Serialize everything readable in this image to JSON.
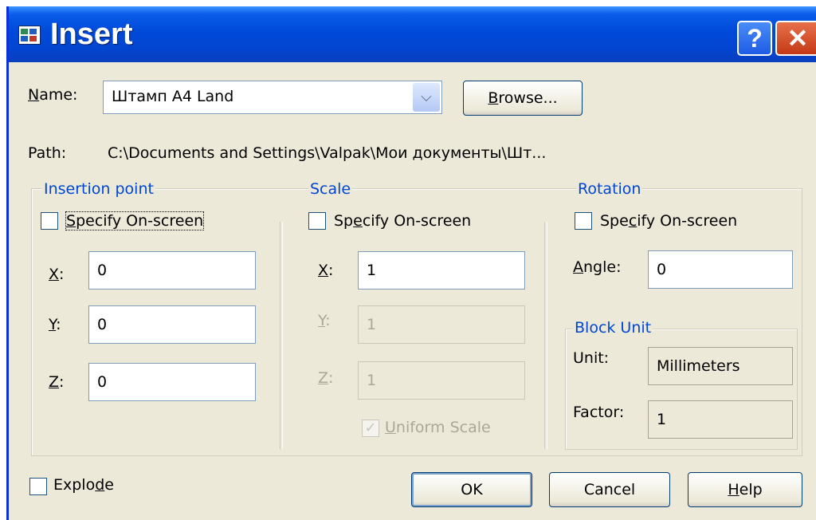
{
  "window": {
    "title": "Insert",
    "help_glyph": "?",
    "close_glyph": "✕",
    "icon": "app-icon"
  },
  "name": {
    "label_u": "N",
    "label_rest": "ame:",
    "value": "Штамп A4 Land",
    "dropdown_icon": "chevron-down-icon"
  },
  "browse": {
    "label_u": "B",
    "label_rest": "rowse..."
  },
  "path": {
    "label": "Path:",
    "value": "C:\\Documents and Settings\\Valpak\\Мои документы\\Шт..."
  },
  "insertion_point": {
    "title": "Insertion point",
    "specify_u": "S",
    "specify_rest": "pecify On-screen",
    "x_label_u": "X",
    "x_label_rest": ":",
    "x_value": "0",
    "y_label_u": "Y",
    "y_label_rest": ":",
    "y_value": "0",
    "z_label_u": "Z",
    "z_label_rest": ":",
    "z_value": "0"
  },
  "scale": {
    "title": "Scale",
    "specify_pre": "Sp",
    "specify_u": "e",
    "specify_rest": "cify On-screen",
    "x_label_u": "X",
    "x_label_rest": ":",
    "x_value": "1",
    "y_label_u": "Y",
    "y_label_rest": ":",
    "y_value": "1",
    "z_label_u": "Z",
    "z_label_rest": ":",
    "z_value": "1",
    "uniform_u": "U",
    "uniform_rest": "niform Scale",
    "uniform_checked": true
  },
  "rotation": {
    "title": "Rotation",
    "specify_pre": "Spe",
    "specify_u": "c",
    "specify_rest": "ify On-screen",
    "angle_label_u": "A",
    "angle_label_rest": "ngle:",
    "angle_value": "0"
  },
  "block_unit": {
    "title": "Block Unit",
    "unit_label": "Unit:",
    "unit_value": "Millimeters",
    "factor_label": "Factor:",
    "factor_value": "1"
  },
  "explode": {
    "label_pre": "Explo",
    "label_u": "d",
    "label_rest": "e",
    "checked": false
  },
  "buttons": {
    "ok": "OK",
    "cancel": "Cancel",
    "help_u": "H",
    "help_rest": "elp"
  },
  "colors": {
    "title_bar": "#0049d9",
    "dialog_bg": "#ece9d8",
    "group_title": "#0046d5"
  }
}
